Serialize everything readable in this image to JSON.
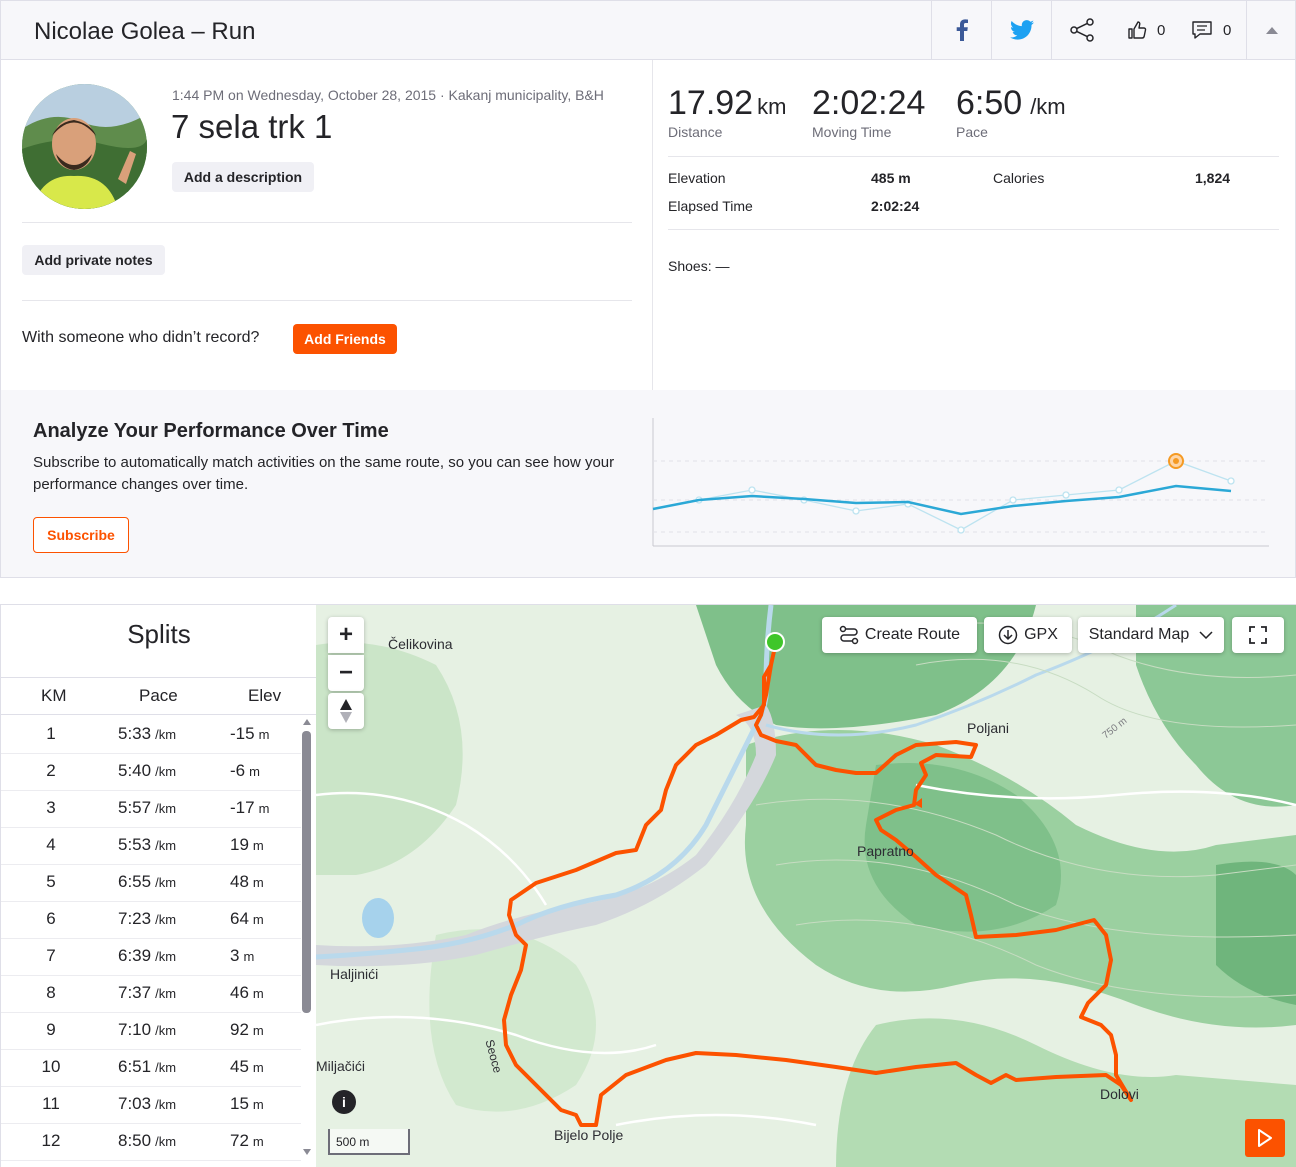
{
  "header": {
    "title": "Nicolae Golea – Run",
    "kudos_count": "0",
    "comments_count": "0"
  },
  "activity": {
    "meta": "1:44 PM on Wednesday, October 28, 2015 · Kakanj municipality, B&H",
    "name": "7 sela trk 1",
    "add_description": "Add a description",
    "add_private_notes": "Add private notes",
    "friends_question": "With someone who didn’t record?",
    "add_friends": "Add Friends"
  },
  "stats": {
    "distance": {
      "value": "17.92",
      "unit": "km",
      "label": "Distance"
    },
    "moving_time": {
      "value": "2:02:24",
      "label": "Moving Time"
    },
    "pace": {
      "value": "6:50",
      "unit": "/km",
      "label": "Pace"
    },
    "elevation": {
      "label": "Elevation",
      "value": "485 m"
    },
    "elapsed_time": {
      "label": "Elapsed Time",
      "value": "2:02:24"
    },
    "calories": {
      "label": "Calories",
      "value": "1,824"
    },
    "shoes": "Shoes: —"
  },
  "analyze": {
    "title": "Analyze Your Performance Over Time",
    "text": "Subscribe to automatically match activities on the same route, so you can see how your performance changes over time.",
    "subscribe": "Subscribe"
  },
  "splits": {
    "title": "Splits",
    "headers": {
      "km": "KM",
      "pace": "Pace",
      "elev": "Elev"
    },
    "pace_unit": "/km",
    "elev_unit": "m",
    "rows": [
      {
        "km": "1",
        "pace": "5:33",
        "elev": "-15"
      },
      {
        "km": "2",
        "pace": "5:40",
        "elev": "-6"
      },
      {
        "km": "3",
        "pace": "5:57",
        "elev": "-17"
      },
      {
        "km": "4",
        "pace": "5:53",
        "elev": "19"
      },
      {
        "km": "5",
        "pace": "6:55",
        "elev": "48"
      },
      {
        "km": "6",
        "pace": "7:23",
        "elev": "64"
      },
      {
        "km": "7",
        "pace": "6:39",
        "elev": "3"
      },
      {
        "km": "8",
        "pace": "7:37",
        "elev": "46"
      },
      {
        "km": "9",
        "pace": "7:10",
        "elev": "92"
      },
      {
        "km": "10",
        "pace": "6:51",
        "elev": "45"
      },
      {
        "km": "11",
        "pace": "7:03",
        "elev": "15"
      },
      {
        "km": "12",
        "pace": "8:50",
        "elev": "72"
      }
    ]
  },
  "map": {
    "create_route": "Create Route",
    "gpx": "GPX",
    "map_type": "Standard Map",
    "zoom_in": "+",
    "zoom_out": "−",
    "scale": "500 m",
    "contour_label": "750 m",
    "places": {
      "celikovina": "Čelikovina",
      "poljani": "Poljani",
      "papratno": "Papratno",
      "haljinici": "Haljinići",
      "miljacici": "Miljačići",
      "seoce": "Seoce",
      "bijelo_polje": "Bijelo Polje",
      "dolovi": "Dolovi"
    },
    "route_color": "#fc5200",
    "start_color": "#3fc62a"
  },
  "colors": {
    "brand": "#fc5200",
    "chart_line": "#2ba8d6"
  }
}
